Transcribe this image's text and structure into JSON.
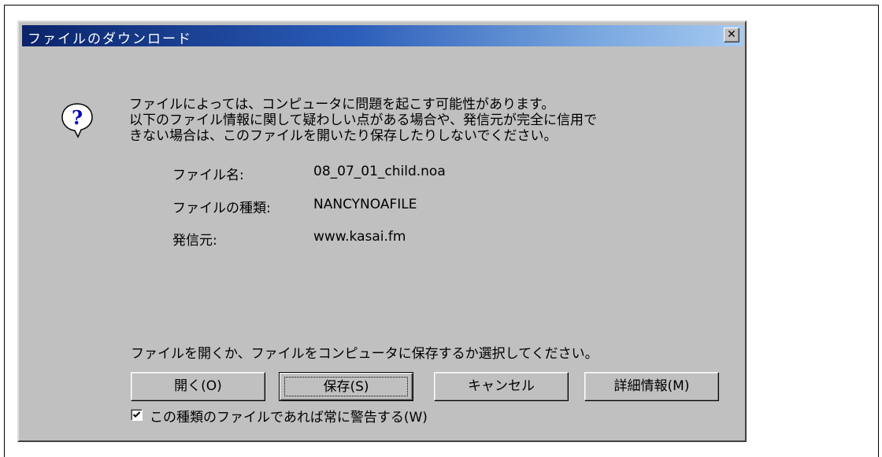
{
  "dialog": {
    "title": "ファイルのダウンロード",
    "close_glyph": "✕",
    "icon": "question-icon"
  },
  "message": {
    "line1": "ファイルによっては、コンピュータに問題を起こす可能性があります。",
    "line2": "以下のファイル情報に関して疑わしい点がある場合や、発信元が完全に信用で",
    "line3": "きない場合は、このファイルを開いたり保存したりしないでください。"
  },
  "file_info": {
    "name_label": "ファイル名:",
    "name_value": "08_07_01_child.noa",
    "type_label": "ファイルの種類:",
    "type_value": "NANCYNOAFILE",
    "source_label": "発信元:",
    "source_value": "www.kasai.fm"
  },
  "prompt": "ファイルを開くか、ファイルをコンピュータに保存するか選択してください。",
  "buttons": {
    "open": "開く(O)",
    "save": "保存(S)",
    "cancel": "キャンセル",
    "details": "詳細情報(M)"
  },
  "checkbox": {
    "checked": true,
    "check_glyph": "✓",
    "label": "この種類のファイルであれば常に警告する(W)"
  },
  "colors": {
    "dialog_bg": "#c0c0c0",
    "titlebar_start": "#0a246a",
    "titlebar_end": "#a6caf0"
  }
}
